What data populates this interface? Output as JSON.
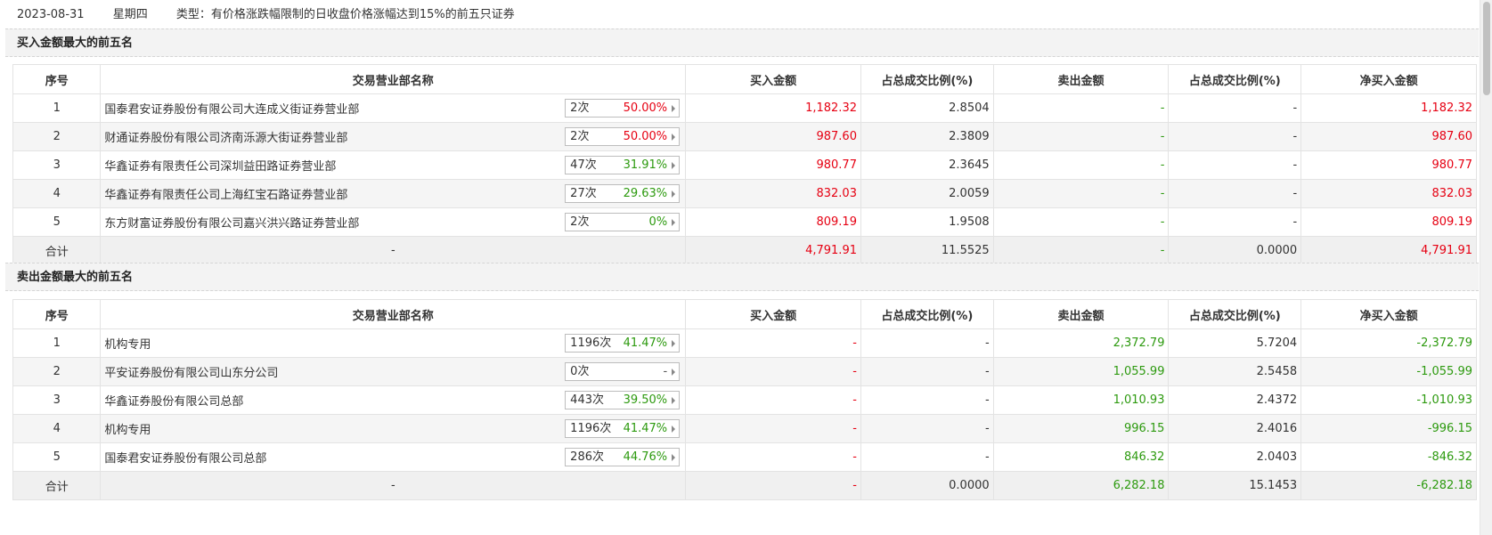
{
  "info": {
    "date": "2023-08-31",
    "weekday": "星期四",
    "type_label": "类型：有价格涨跌幅限制的日收盘价格涨幅达到15%的前五只证券"
  },
  "columns": {
    "seq": "序号",
    "dept": "交易营业部名称",
    "buy": "买入金额",
    "buy_ratio": "占总成交比例(%)",
    "sell": "卖出金额",
    "sell_ratio": "占总成交比例(%)",
    "net": "净买入金额"
  },
  "buy_section": {
    "title": "买入金额最大的前五名",
    "rows": [
      {
        "seq": "1",
        "name": "国泰君安证券股份有限公司大连成义街证券营业部",
        "count": "2次",
        "pct": "50.00%",
        "pct_color": "red",
        "buy": "1,182.32",
        "buy_ratio": "2.8504",
        "sell": "-",
        "sell_ratio": "-",
        "net": "1,182.32"
      },
      {
        "seq": "2",
        "name": "财通证券股份有限公司济南泺源大街证券营业部",
        "count": "2次",
        "pct": "50.00%",
        "pct_color": "red",
        "buy": "987.60",
        "buy_ratio": "2.3809",
        "sell": "-",
        "sell_ratio": "-",
        "net": "987.60"
      },
      {
        "seq": "3",
        "name": "华鑫证券有限责任公司深圳益田路证券营业部",
        "count": "47次",
        "pct": "31.91%",
        "pct_color": "green",
        "buy": "980.77",
        "buy_ratio": "2.3645",
        "sell": "-",
        "sell_ratio": "-",
        "net": "980.77"
      },
      {
        "seq": "4",
        "name": "华鑫证券有限责任公司上海红宝石路证券营业部",
        "count": "27次",
        "pct": "29.63%",
        "pct_color": "green",
        "buy": "832.03",
        "buy_ratio": "2.0059",
        "sell": "-",
        "sell_ratio": "-",
        "net": "832.03"
      },
      {
        "seq": "5",
        "name": "东方财富证券股份有限公司嘉兴洪兴路证券营业部",
        "count": "2次",
        "pct": "0%",
        "pct_color": "green",
        "buy": "809.19",
        "buy_ratio": "1.9508",
        "sell": "-",
        "sell_ratio": "-",
        "net": "809.19"
      }
    ],
    "total": {
      "label": "合计",
      "name": "-",
      "buy": "4,791.91",
      "buy_ratio": "11.5525",
      "sell": "-",
      "sell_ratio": "0.0000",
      "net": "4,791.91"
    }
  },
  "sell_section": {
    "title": "卖出金额最大的前五名",
    "rows": [
      {
        "seq": "1",
        "name": "机构专用",
        "count": "1196次",
        "pct": "41.47%",
        "pct_color": "green",
        "buy": "-",
        "buy_ratio": "-",
        "sell": "2,372.79",
        "sell_ratio": "5.7204",
        "net": "-2,372.79"
      },
      {
        "seq": "2",
        "name": "平安证券股份有限公司山东分公司",
        "count": "0次",
        "pct": "-",
        "pct_color": "gray",
        "buy": "-",
        "buy_ratio": "-",
        "sell": "1,055.99",
        "sell_ratio": "2.5458",
        "net": "-1,055.99"
      },
      {
        "seq": "3",
        "name": "华鑫证券股份有限公司总部",
        "count": "443次",
        "pct": "39.50%",
        "pct_color": "green",
        "buy": "-",
        "buy_ratio": "-",
        "sell": "1,010.93",
        "sell_ratio": "2.4372",
        "net": "-1,010.93"
      },
      {
        "seq": "4",
        "name": "机构专用",
        "count": "1196次",
        "pct": "41.47%",
        "pct_color": "green",
        "buy": "-",
        "buy_ratio": "-",
        "sell": "996.15",
        "sell_ratio": "2.4016",
        "net": "-996.15"
      },
      {
        "seq": "5",
        "name": "国泰君安证券股份有限公司总部",
        "count": "286次",
        "pct": "44.76%",
        "pct_color": "green",
        "buy": "-",
        "buy_ratio": "-",
        "sell": "846.32",
        "sell_ratio": "2.0403",
        "net": "-846.32"
      }
    ],
    "total": {
      "label": "合计",
      "name": "-",
      "buy": "-",
      "buy_ratio": "0.0000",
      "sell": "6,282.18",
      "sell_ratio": "15.1453",
      "net": "-6,282.18"
    }
  },
  "colors": {
    "buy_value": "#e60012",
    "sell_value": "#2d9a0f",
    "row_even_bg": "#f5f5f5",
    "section_bg": "#f3f3f3"
  }
}
